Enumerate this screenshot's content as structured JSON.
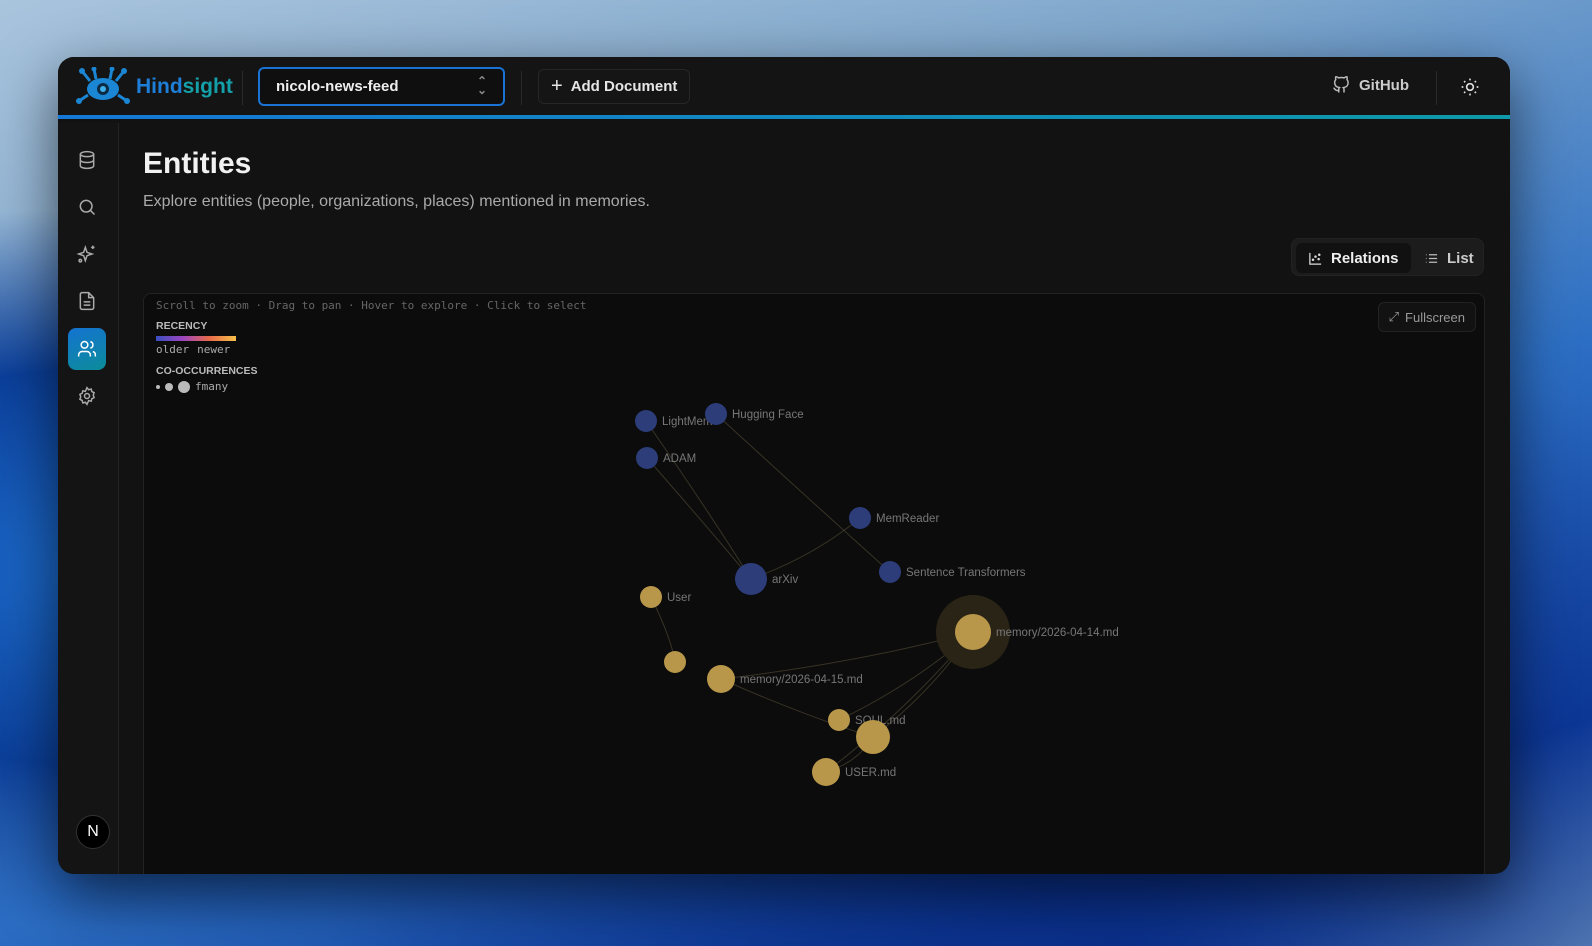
{
  "app": {
    "name_a": "Hind",
    "name_b": "sight"
  },
  "header": {
    "bank_selector": "nicolo-news-feed",
    "add_document": "Add Document",
    "github": "GitHub"
  },
  "sidebar": {
    "items": [
      {
        "icon": "database-icon"
      },
      {
        "icon": "search-icon"
      },
      {
        "icon": "sparkles-icon"
      },
      {
        "icon": "document-icon"
      },
      {
        "icon": "users-icon",
        "active": true
      },
      {
        "icon": "gear-icon"
      }
    ],
    "avatar": "N"
  },
  "page": {
    "title": "Entities",
    "subtitle": "Explore entities (people, organizations, places) mentioned in memories."
  },
  "view_toggle": {
    "relations": "Relations",
    "list": "List",
    "selected": "Relations"
  },
  "graph": {
    "hint": "Scroll to zoom · Drag to pan · Hover to explore · Click to select",
    "fullscreen": "Fullscreen",
    "legend": {
      "recency_title": "RECENCY",
      "older": "older",
      "newer": "newer",
      "cooc_title": "CO-OCCURRENCES",
      "cooc_label": "fmany"
    },
    "colors": {
      "older": "#2c3d7a",
      "newer": "#b8974a"
    },
    "nodes": [
      {
        "label": "LightMem",
        "recency": "older"
      },
      {
        "label": "Hugging Face",
        "recency": "older"
      },
      {
        "label": "ADAM",
        "recency": "older"
      },
      {
        "label": "MemReader",
        "recency": "older"
      },
      {
        "label": "arXiv",
        "recency": "older"
      },
      {
        "label": "Sentence Transformers",
        "recency": "older"
      },
      {
        "label": "User",
        "recency": "newer"
      },
      {
        "label": "",
        "recency": "newer"
      },
      {
        "label": "memory/2026-04-15.md",
        "recency": "newer"
      },
      {
        "label": "memory/2026-04-14.md",
        "recency": "newer",
        "highlighted": true
      },
      {
        "label": "SOUL.md",
        "recency": "newer"
      },
      {
        "label": "",
        "recency": "newer"
      },
      {
        "label": "USER.md",
        "recency": "newer"
      }
    ]
  }
}
